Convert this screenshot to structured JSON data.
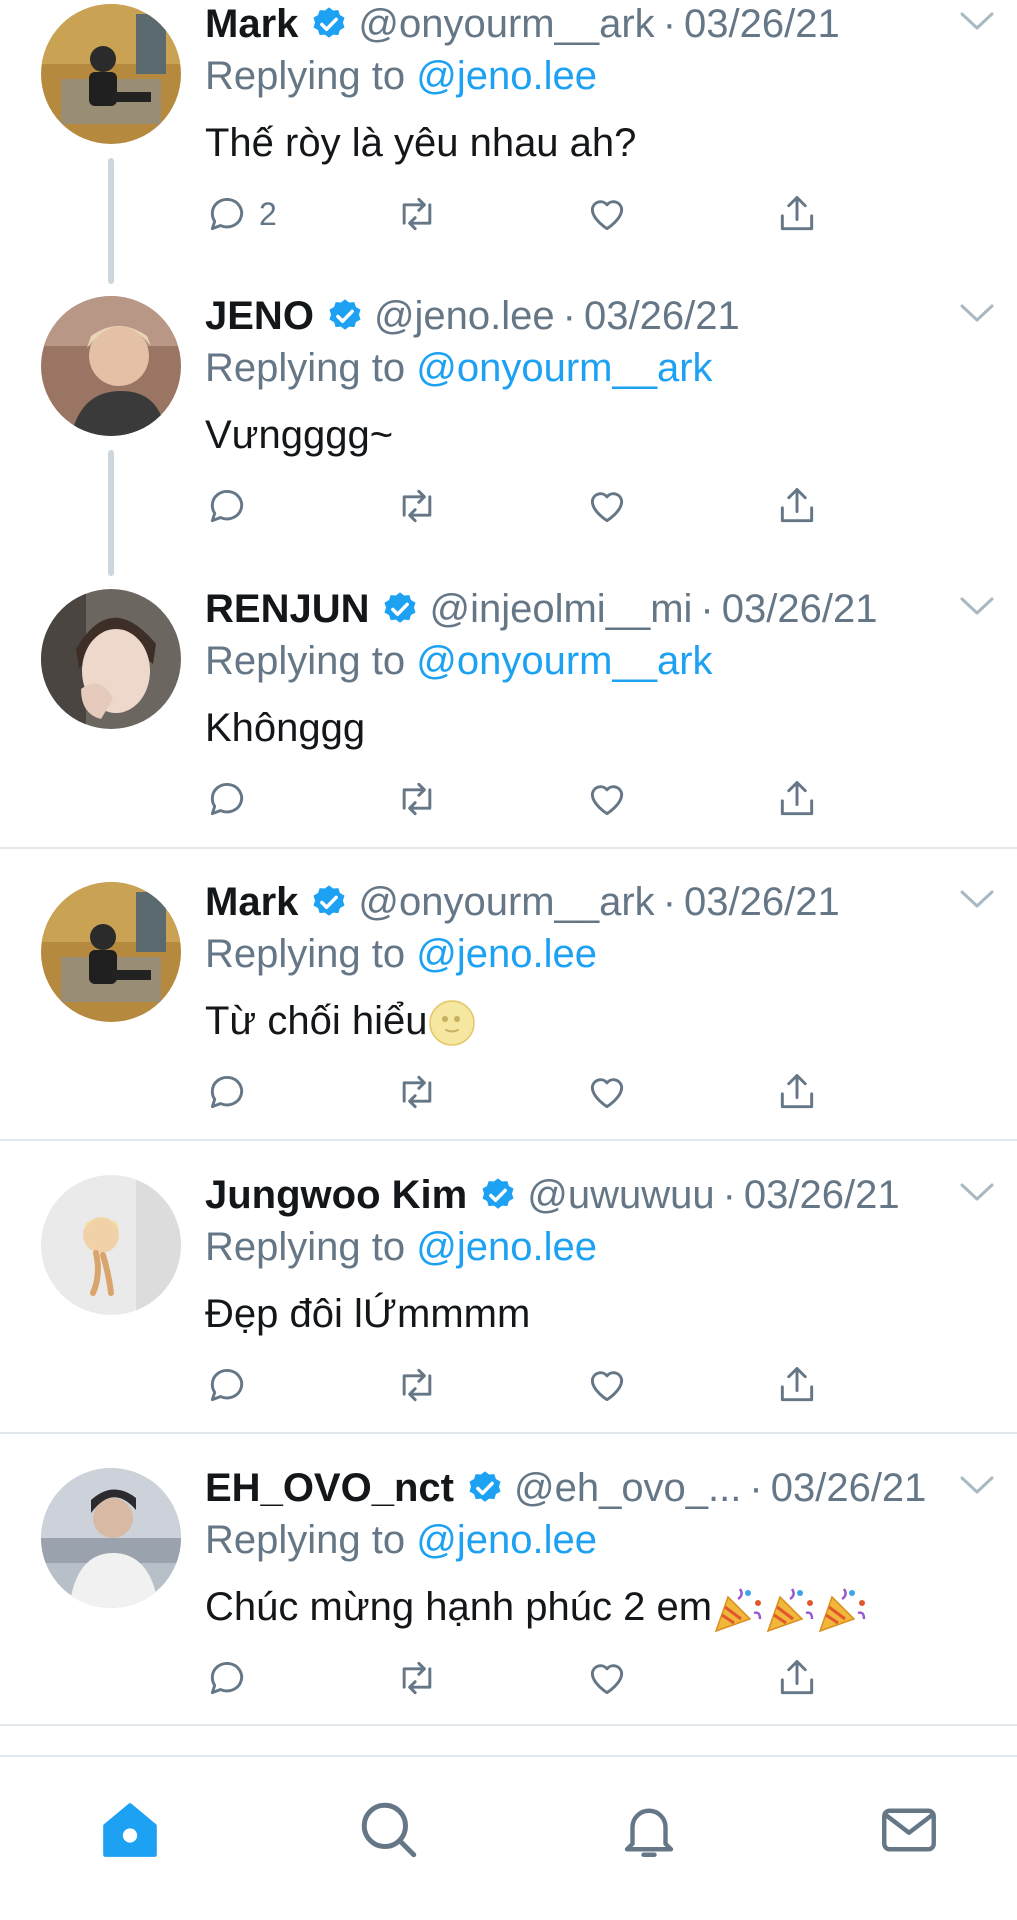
{
  "tweets": [
    {
      "name": "Mark",
      "handle": "@onyourm__ark",
      "separator": "·",
      "date": "03/26/21",
      "replying_prefix": "Replying to",
      "replying_to": "@jeno.lee",
      "text": "Thế ròy là yêu nhau ah?",
      "reply_count": "2",
      "avatar_icon": "avatar-photo-mark"
    },
    {
      "name": "JENO",
      "handle": "@jeno.lee",
      "separator": "·",
      "date": "03/26/21",
      "replying_prefix": "Replying to",
      "replying_to": "@onyourm__ark",
      "text": "Vưngggg~",
      "reply_count": "",
      "avatar_icon": "avatar-photo-jeno"
    },
    {
      "name": "RENJUN",
      "handle": "@injeolmi__mi",
      "separator": "·",
      "date": "03/26/21",
      "replying_prefix": "Replying to",
      "replying_to": "@onyourm__ark",
      "text": "Khônggg",
      "reply_count": "",
      "avatar_icon": "avatar-photo-renjun"
    },
    {
      "name": "Mark",
      "handle": "@onyourm__ark",
      "separator": "·",
      "date": "03/26/21",
      "replying_prefix": "Replying to",
      "replying_to": "@jeno.lee",
      "text": "Từ chối hiểu",
      "reply_count": "",
      "avatar_icon": "avatar-photo-mark"
    },
    {
      "name": "Jungwoo Kim",
      "handle": "@uwuwuu",
      "separator": "·",
      "date": "03/26/21",
      "replying_prefix": "Replying to",
      "replying_to": "@jeno.lee",
      "text": "Đẹp đôi lỨmmmm",
      "reply_count": "",
      "avatar_icon": "avatar-photo-jungwoo"
    },
    {
      "name": "EH_OVO_nct",
      "handle": "@eh_ovo_...",
      "separator": "·",
      "date": "03/26/21",
      "replying_prefix": "Replying to",
      "replying_to": "@jeno.lee",
      "text": "Chúc mừng hạnh phúc 2 em",
      "reply_count": "",
      "avatar_icon": "avatar-photo-eh-ovo"
    }
  ],
  "emojis": {
    "moon_face": "full-moon-face-emoji",
    "party_popper": "party-popper-emoji"
  },
  "tabbar": {
    "home": "home-icon",
    "search": "search-icon",
    "notifications": "bell-icon",
    "messages": "mail-icon"
  },
  "colors": {
    "accent": "#1da1f2",
    "muted": "#657786",
    "text": "#14171a",
    "divider": "#e1e8ed",
    "thread_line": "#ccd6dd"
  }
}
